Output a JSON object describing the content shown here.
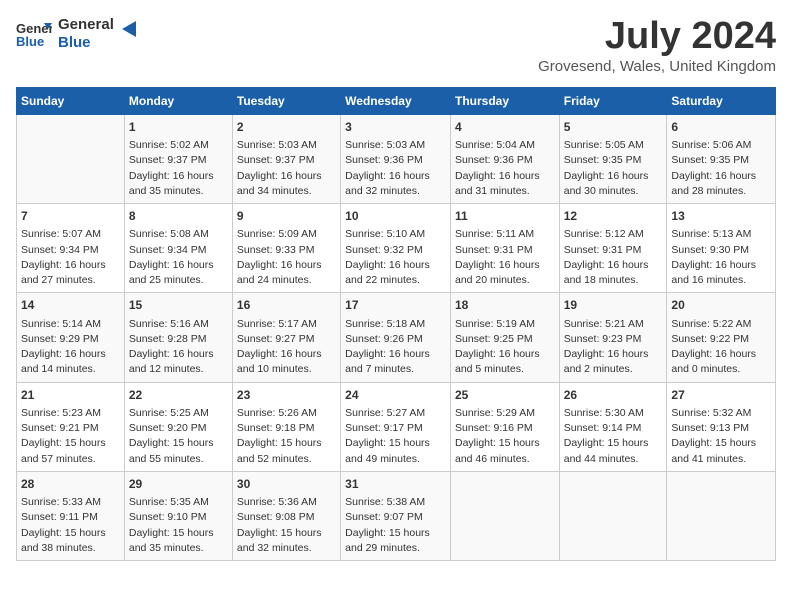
{
  "logo": {
    "general": "General",
    "blue": "Blue"
  },
  "title": "July 2024",
  "location": "Grovesend, Wales, United Kingdom",
  "weekdays": [
    "Sunday",
    "Monday",
    "Tuesday",
    "Wednesday",
    "Thursday",
    "Friday",
    "Saturday"
  ],
  "weeks": [
    [
      {
        "day": "",
        "info": ""
      },
      {
        "day": "1",
        "info": "Sunrise: 5:02 AM\nSunset: 9:37 PM\nDaylight: 16 hours\nand 35 minutes."
      },
      {
        "day": "2",
        "info": "Sunrise: 5:03 AM\nSunset: 9:37 PM\nDaylight: 16 hours\nand 34 minutes."
      },
      {
        "day": "3",
        "info": "Sunrise: 5:03 AM\nSunset: 9:36 PM\nDaylight: 16 hours\nand 32 minutes."
      },
      {
        "day": "4",
        "info": "Sunrise: 5:04 AM\nSunset: 9:36 PM\nDaylight: 16 hours\nand 31 minutes."
      },
      {
        "day": "5",
        "info": "Sunrise: 5:05 AM\nSunset: 9:35 PM\nDaylight: 16 hours\nand 30 minutes."
      },
      {
        "day": "6",
        "info": "Sunrise: 5:06 AM\nSunset: 9:35 PM\nDaylight: 16 hours\nand 28 minutes."
      }
    ],
    [
      {
        "day": "7",
        "info": "Sunrise: 5:07 AM\nSunset: 9:34 PM\nDaylight: 16 hours\nand 27 minutes."
      },
      {
        "day": "8",
        "info": "Sunrise: 5:08 AM\nSunset: 9:34 PM\nDaylight: 16 hours\nand 25 minutes."
      },
      {
        "day": "9",
        "info": "Sunrise: 5:09 AM\nSunset: 9:33 PM\nDaylight: 16 hours\nand 24 minutes."
      },
      {
        "day": "10",
        "info": "Sunrise: 5:10 AM\nSunset: 9:32 PM\nDaylight: 16 hours\nand 22 minutes."
      },
      {
        "day": "11",
        "info": "Sunrise: 5:11 AM\nSunset: 9:31 PM\nDaylight: 16 hours\nand 20 minutes."
      },
      {
        "day": "12",
        "info": "Sunrise: 5:12 AM\nSunset: 9:31 PM\nDaylight: 16 hours\nand 18 minutes."
      },
      {
        "day": "13",
        "info": "Sunrise: 5:13 AM\nSunset: 9:30 PM\nDaylight: 16 hours\nand 16 minutes."
      }
    ],
    [
      {
        "day": "14",
        "info": "Sunrise: 5:14 AM\nSunset: 9:29 PM\nDaylight: 16 hours\nand 14 minutes."
      },
      {
        "day": "15",
        "info": "Sunrise: 5:16 AM\nSunset: 9:28 PM\nDaylight: 16 hours\nand 12 minutes."
      },
      {
        "day": "16",
        "info": "Sunrise: 5:17 AM\nSunset: 9:27 PM\nDaylight: 16 hours\nand 10 minutes."
      },
      {
        "day": "17",
        "info": "Sunrise: 5:18 AM\nSunset: 9:26 PM\nDaylight: 16 hours\nand 7 minutes."
      },
      {
        "day": "18",
        "info": "Sunrise: 5:19 AM\nSunset: 9:25 PM\nDaylight: 16 hours\nand 5 minutes."
      },
      {
        "day": "19",
        "info": "Sunrise: 5:21 AM\nSunset: 9:23 PM\nDaylight: 16 hours\nand 2 minutes."
      },
      {
        "day": "20",
        "info": "Sunrise: 5:22 AM\nSunset: 9:22 PM\nDaylight: 16 hours\nand 0 minutes."
      }
    ],
    [
      {
        "day": "21",
        "info": "Sunrise: 5:23 AM\nSunset: 9:21 PM\nDaylight: 15 hours\nand 57 minutes."
      },
      {
        "day": "22",
        "info": "Sunrise: 5:25 AM\nSunset: 9:20 PM\nDaylight: 15 hours\nand 55 minutes."
      },
      {
        "day": "23",
        "info": "Sunrise: 5:26 AM\nSunset: 9:18 PM\nDaylight: 15 hours\nand 52 minutes."
      },
      {
        "day": "24",
        "info": "Sunrise: 5:27 AM\nSunset: 9:17 PM\nDaylight: 15 hours\nand 49 minutes."
      },
      {
        "day": "25",
        "info": "Sunrise: 5:29 AM\nSunset: 9:16 PM\nDaylight: 15 hours\nand 46 minutes."
      },
      {
        "day": "26",
        "info": "Sunrise: 5:30 AM\nSunset: 9:14 PM\nDaylight: 15 hours\nand 44 minutes."
      },
      {
        "day": "27",
        "info": "Sunrise: 5:32 AM\nSunset: 9:13 PM\nDaylight: 15 hours\nand 41 minutes."
      }
    ],
    [
      {
        "day": "28",
        "info": "Sunrise: 5:33 AM\nSunset: 9:11 PM\nDaylight: 15 hours\nand 38 minutes."
      },
      {
        "day": "29",
        "info": "Sunrise: 5:35 AM\nSunset: 9:10 PM\nDaylight: 15 hours\nand 35 minutes."
      },
      {
        "day": "30",
        "info": "Sunrise: 5:36 AM\nSunset: 9:08 PM\nDaylight: 15 hours\nand 32 minutes."
      },
      {
        "day": "31",
        "info": "Sunrise: 5:38 AM\nSunset: 9:07 PM\nDaylight: 15 hours\nand 29 minutes."
      },
      {
        "day": "",
        "info": ""
      },
      {
        "day": "",
        "info": ""
      },
      {
        "day": "",
        "info": ""
      }
    ]
  ]
}
